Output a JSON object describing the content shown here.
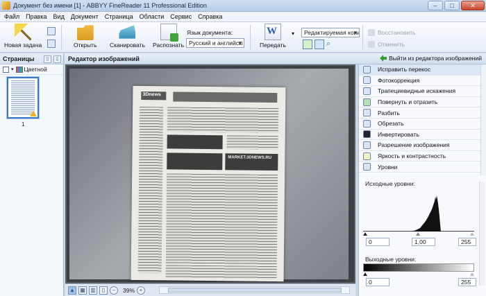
{
  "window": {
    "title": "Документ без имени [1] - ABBYY FineReader 11 Professional Edition",
    "controls": {
      "minimize": "–",
      "maximize": "□",
      "close": "✕"
    }
  },
  "menu": [
    "Файл",
    "Правка",
    "Вид",
    "Документ",
    "Страница",
    "Области",
    "Сервис",
    "Справка"
  ],
  "toolbar": {
    "new_task": "Новая задача",
    "open": "Открыть",
    "scan": "Сканировать",
    "read": "Распознать",
    "lang_label": "Язык документа:",
    "lang_value": "Русский и английскі",
    "send": "Передать",
    "mode_value": "Редактируемая копи",
    "restore": "Восстановить",
    "undo": "Отменить"
  },
  "pages_panel": {
    "title": "Страницы",
    "color_mode": "Цветной",
    "page_number": "1"
  },
  "editor": {
    "title": "Редактор изображений",
    "exit": "Выйти из редактора изображений",
    "zoom": "39%",
    "scan_banner_1": "MARKET.3DNEWS.RU",
    "scan_logo": "3Dnews"
  },
  "tools": [
    "Исправить перекос",
    "Фотокоррекция",
    "Трапециевидные искажения",
    "Повернуть и отразить",
    "Разбить",
    "Обрезать",
    "Инвертировать",
    "Разрешение изображения",
    "Яркость и контрастность",
    "Уровни"
  ],
  "levels": {
    "input_label": "Исходные уровни:",
    "in_min": "0",
    "in_gamma": "1,00",
    "in_max": "255",
    "output_label": "Выходные уровни:",
    "out_min": "0",
    "out_max": "255"
  }
}
